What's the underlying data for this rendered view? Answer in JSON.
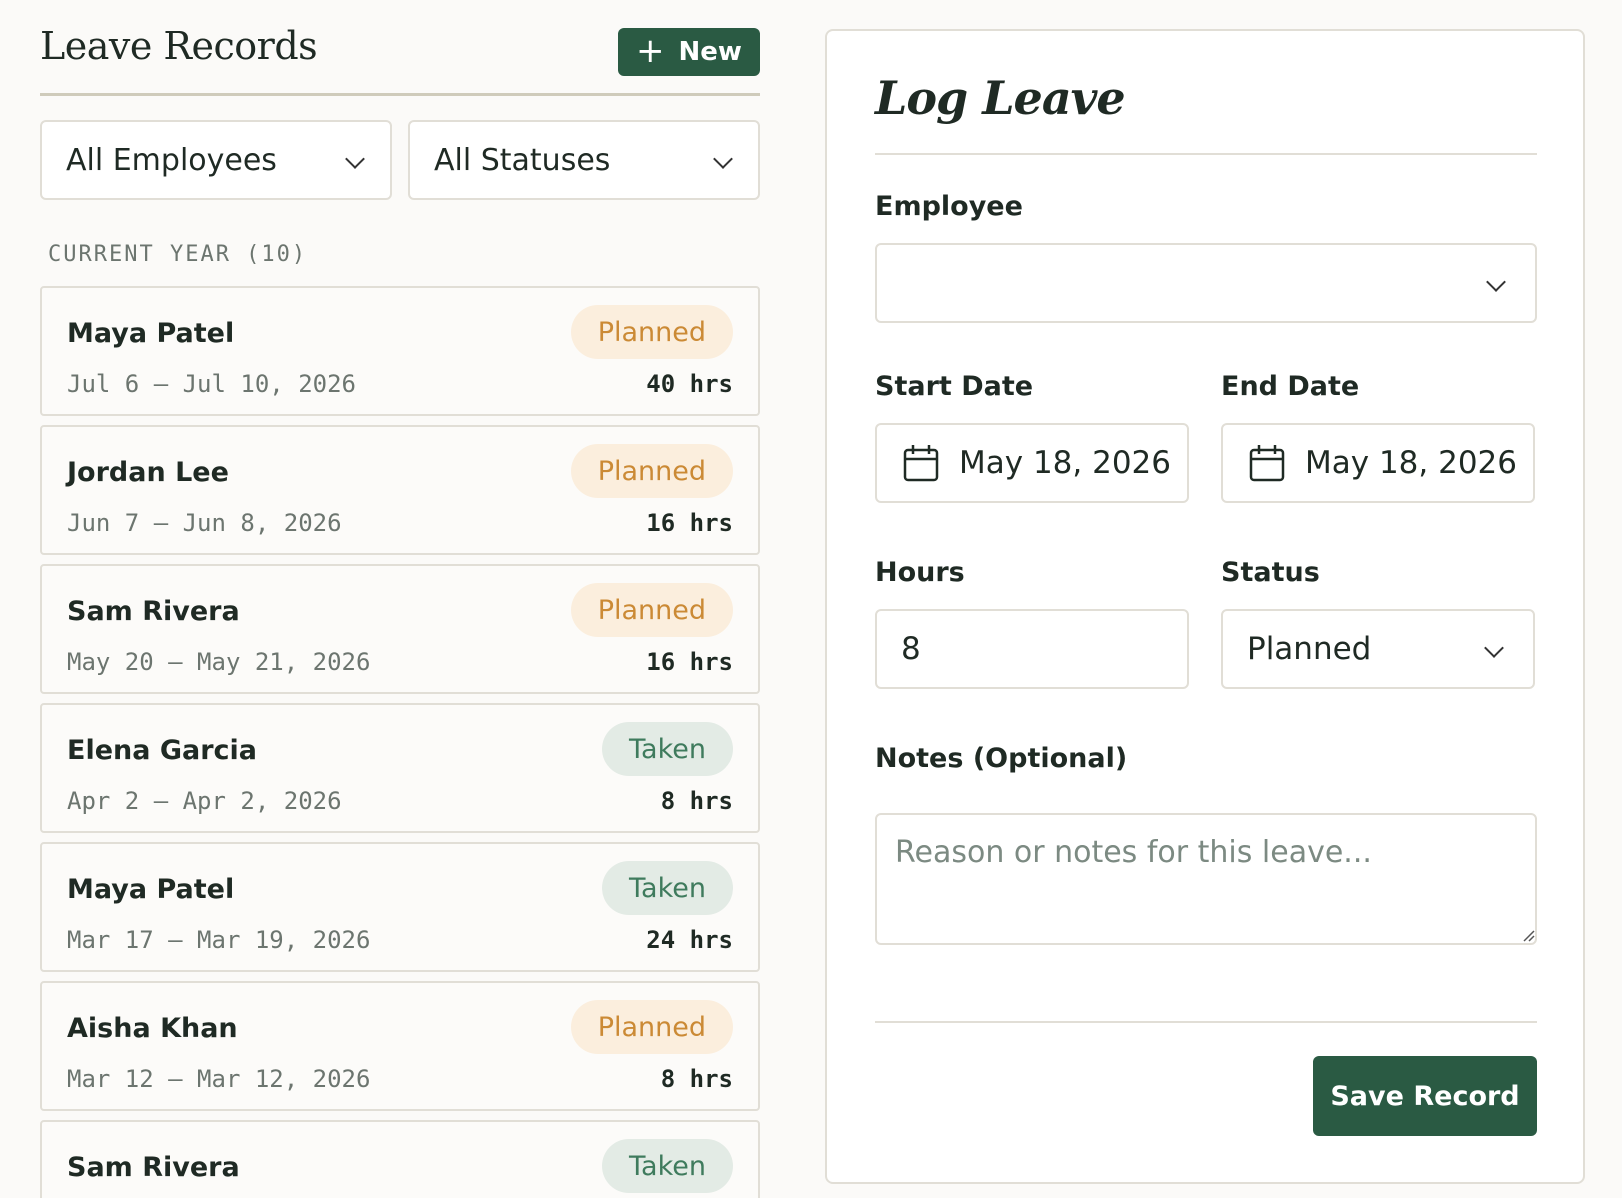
{
  "list": {
    "title": "Leave Records",
    "new_label": "New",
    "filters": {
      "employee": "All Employees",
      "status": "All Statuses"
    },
    "section_label": "CURRENT YEAR (10)",
    "records": [
      {
        "name": "Maya Patel",
        "dates": "Jul 6 – Jul 10, 2026",
        "hours": "40 hrs",
        "status": "Planned"
      },
      {
        "name": "Jordan Lee",
        "dates": "Jun 7 – Jun 8, 2026",
        "hours": "16 hrs",
        "status": "Planned"
      },
      {
        "name": "Sam Rivera",
        "dates": "May 20 – May 21, 2026",
        "hours": "16 hrs",
        "status": "Planned"
      },
      {
        "name": "Elena Garcia",
        "dates": "Apr 2 – Apr 2, 2026",
        "hours": "8 hrs",
        "status": "Taken"
      },
      {
        "name": "Maya Patel",
        "dates": "Mar 17 – Mar 19, 2026",
        "hours": "24 hrs",
        "status": "Taken"
      },
      {
        "name": "Aisha Khan",
        "dates": "Mar 12 – Mar 12, 2026",
        "hours": "8 hrs",
        "status": "Planned"
      },
      {
        "name": "Sam Rivera",
        "dates": "",
        "hours": "",
        "status": "Taken"
      }
    ]
  },
  "form": {
    "title": "Log Leave",
    "employee_label": "Employee",
    "employee_value": "",
    "start_label": "Start Date",
    "start_value": "May 18, 2026",
    "end_label": "End Date",
    "end_value": "May 18, 2026",
    "hours_label": "Hours",
    "hours_value": "8",
    "status_label": "Status",
    "status_value": "Planned",
    "notes_label": "Notes (Optional)",
    "notes_placeholder": "Reason or notes for this leave...",
    "save_label": "Save Record"
  },
  "colors": {
    "accent": "#2a5a43",
    "planned_bg": "#fbeedd",
    "planned_text": "#cb8a35",
    "taken_bg": "#e3ebe5",
    "taken_text": "#3f7b5d"
  }
}
